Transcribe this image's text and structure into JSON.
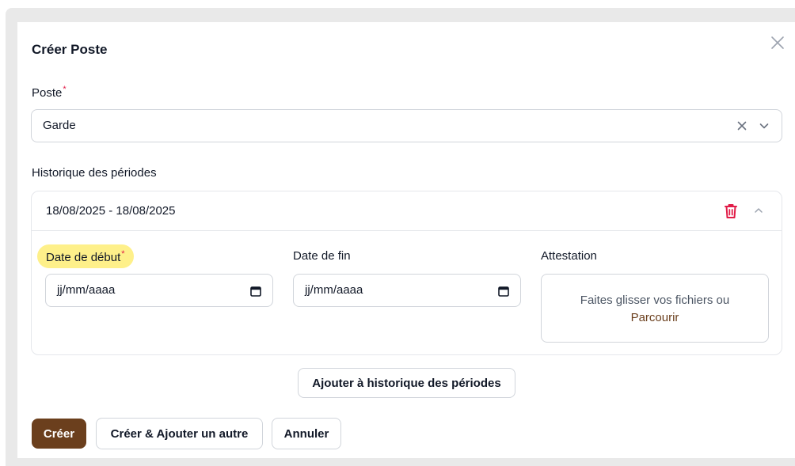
{
  "modal": {
    "title": "Créer Poste",
    "close_icon": "close-icon"
  },
  "poste": {
    "label": "Poste",
    "required_marker": "*",
    "value": "Garde",
    "clear_icon": "clear-icon",
    "chevron_icon": "chevron-down-icon"
  },
  "history": {
    "label": "Historique des périodes",
    "periods": [
      {
        "title": "18/08/2025 - 18/08/2025",
        "start": {
          "label": "Date de début",
          "required_marker": "*",
          "placeholder": "jj/mm/aaaa"
        },
        "end": {
          "label": "Date de fin",
          "placeholder": "jj/mm/aaaa"
        },
        "attestation": {
          "label": "Attestation",
          "dropzone_text": "Faites glisser vos fichiers ou",
          "browse_link": "Parcourir"
        }
      }
    ],
    "add_button": "Ajouter à historique des périodes"
  },
  "actions": {
    "create": "Créer",
    "create_another": "Créer & Ajouter un autre",
    "cancel": "Annuler"
  },
  "colors": {
    "primary": "#6b3f1d",
    "danger": "#e11d48",
    "highlight": "#fef08a",
    "backdrop": "#e9e9e9"
  }
}
